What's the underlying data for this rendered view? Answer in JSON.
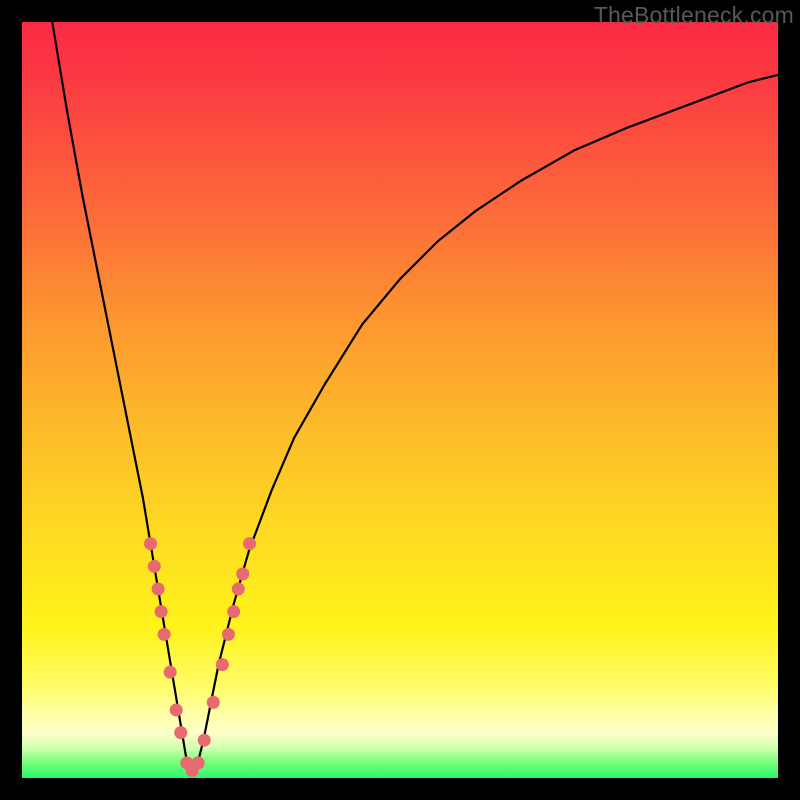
{
  "watermark": "TheBottleneck.com",
  "chart_data": {
    "type": "line",
    "title": "",
    "xlabel": "",
    "ylabel": "",
    "xlim": [
      0,
      100
    ],
    "ylim": [
      0,
      100
    ],
    "grid": false,
    "legend": false,
    "domain_note": "V-shaped bottleneck curve on red→green gradient; minimum (optimal) near x≈22",
    "series": [
      {
        "name": "bottleneck-curve",
        "color": "#000000",
        "x": [
          4,
          6,
          8,
          10,
          12,
          14,
          16,
          18,
          19,
          20,
          21,
          22,
          23,
          24,
          25,
          26,
          28,
          30,
          33,
          36,
          40,
          45,
          50,
          55,
          60,
          66,
          73,
          80,
          88,
          96,
          100
        ],
        "y": [
          100,
          88,
          77,
          67,
          57,
          47,
          37,
          25,
          19,
          13,
          7,
          1,
          1,
          5,
          10,
          15,
          23,
          30,
          38,
          45,
          52,
          60,
          66,
          71,
          75,
          79,
          83,
          86,
          89,
          92,
          93
        ]
      }
    ],
    "markers": [
      {
        "name": "highlight-dots-left",
        "color": "#e66a6f",
        "shape": "circle",
        "points": [
          {
            "x": 17.0,
            "y": 31
          },
          {
            "x": 17.5,
            "y": 28
          },
          {
            "x": 18.0,
            "y": 25
          },
          {
            "x": 18.4,
            "y": 22
          },
          {
            "x": 18.8,
            "y": 19
          },
          {
            "x": 19.6,
            "y": 14
          },
          {
            "x": 20.4,
            "y": 9
          },
          {
            "x": 21.0,
            "y": 6
          },
          {
            "x": 21.8,
            "y": 2
          },
          {
            "x": 22.5,
            "y": 1
          }
        ]
      },
      {
        "name": "highlight-dots-right",
        "color": "#e66a6f",
        "shape": "circle",
        "points": [
          {
            "x": 23.3,
            "y": 2
          },
          {
            "x": 24.1,
            "y": 5
          },
          {
            "x": 25.3,
            "y": 10
          },
          {
            "x": 26.5,
            "y": 15
          },
          {
            "x": 27.3,
            "y": 19
          },
          {
            "x": 28.0,
            "y": 22
          },
          {
            "x": 28.6,
            "y": 25
          },
          {
            "x": 29.2,
            "y": 27
          },
          {
            "x": 30.1,
            "y": 31
          }
        ]
      }
    ]
  }
}
